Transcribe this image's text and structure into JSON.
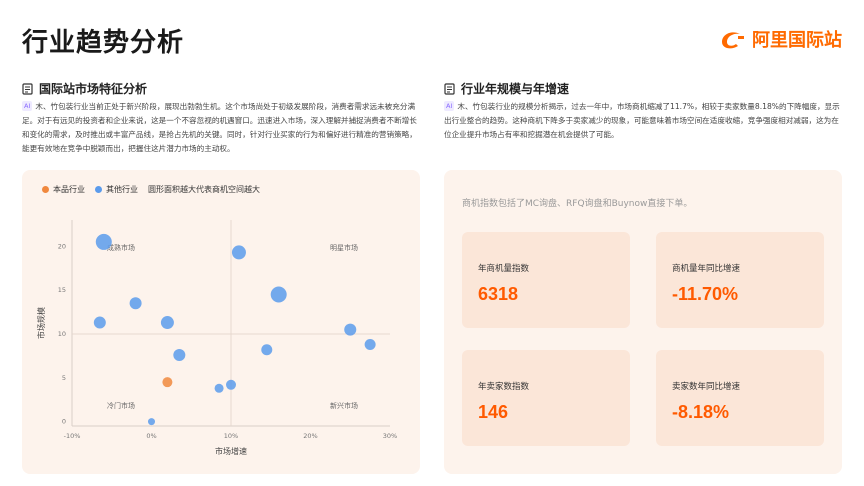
{
  "header": {
    "title": "行业趋势分析",
    "logo_text": "阿里国际站"
  },
  "left_section": {
    "heading": "国际站市场特征分析",
    "ai_tag": "AI",
    "paragraph": "木、竹包装行业当前正处于新兴阶段，展现出勃勃生机。这个市场尚处于初级发展阶段，消费者需求远未被充分满足。对于有远见的投资者和企业来说，这是一个不容忽视的机遇窗口。迅速进入市场，深入理解并捕捉消费者不断增长和变化的需求，及时推出或丰富产品线，是抢占先机的关键。同时，针对行业买家的行为和偏好进行精准的营销策略，能更有效地在竞争中脱颖而出，把握住这片潜力市场的主动权。"
  },
  "right_section": {
    "heading": "行业年规模与年增速",
    "ai_tag": "AI",
    "paragraph": "木、竹包装行业的规模分析揭示，过去一年中，市场商机缩减了11.7%，相较于卖家数量8.18%的下降幅度，显示出行业整合的趋势。这种商机下降多于卖家减少的现象，可能意味着市场空间在适度收缩，竞争强度相对减弱，这为在位企业提升市场占有率和挖掘潜在机会提供了可能。",
    "note": "商机指数包括了MC询盘、RFQ询盘和Buynow直接下单。",
    "stats": [
      {
        "label": "年商机量指数",
        "value": "6318"
      },
      {
        "label": "商机量年同比增速",
        "value": "-11.70%"
      },
      {
        "label": "年卖家数指数",
        "value": "146"
      },
      {
        "label": "卖家数年同比增速",
        "value": "-8.18%"
      }
    ]
  },
  "chart_data": {
    "type": "scatter",
    "legend": [
      {
        "name": "本品行业",
        "color": "#f0883e"
      },
      {
        "name": "其他行业",
        "color": "#5b9bec"
      },
      {
        "name": "圆形面积越大代表商机空间越大",
        "color": ""
      }
    ],
    "xlabel": "市场增速",
    "ylabel": "市场规模",
    "x_ticks": [
      "-10%",
      "0%",
      "10%",
      "20%",
      "30%"
    ],
    "y_ticks": [
      "0",
      "5",
      "10",
      "15",
      "20"
    ],
    "xlim": [
      -10,
      30
    ],
    "ylim": [
      -0.5,
      23
    ],
    "divider": {
      "x": 10,
      "y": 10
    },
    "quadrants": [
      "成熟市场",
      "明星市场",
      "冷门市场",
      "新兴市场"
    ],
    "series": [
      {
        "name": "本品行业",
        "points": [
          {
            "x": 2,
            "y": 4.5,
            "size": 5
          }
        ]
      },
      {
        "name": "其他行业",
        "points": [
          {
            "x": -6,
            "y": 20.5,
            "size": 8
          },
          {
            "x": 11,
            "y": 19.3,
            "size": 7
          },
          {
            "x": -2,
            "y": 13.5,
            "size": 6
          },
          {
            "x": 16,
            "y": 14.5,
            "size": 8
          },
          {
            "x": -6.5,
            "y": 11.3,
            "size": 6
          },
          {
            "x": 2,
            "y": 11.3,
            "size": 6.5
          },
          {
            "x": 25,
            "y": 10.5,
            "size": 6
          },
          {
            "x": 27.5,
            "y": 8.8,
            "size": 5.5
          },
          {
            "x": 3.5,
            "y": 7.6,
            "size": 6
          },
          {
            "x": 14.5,
            "y": 8.2,
            "size": 5.5
          },
          {
            "x": 10,
            "y": 4.2,
            "size": 5
          },
          {
            "x": 8.5,
            "y": 3.8,
            "size": 4.5
          },
          {
            "x": 0,
            "y": 0,
            "size": 3.5
          }
        ]
      }
    ]
  }
}
